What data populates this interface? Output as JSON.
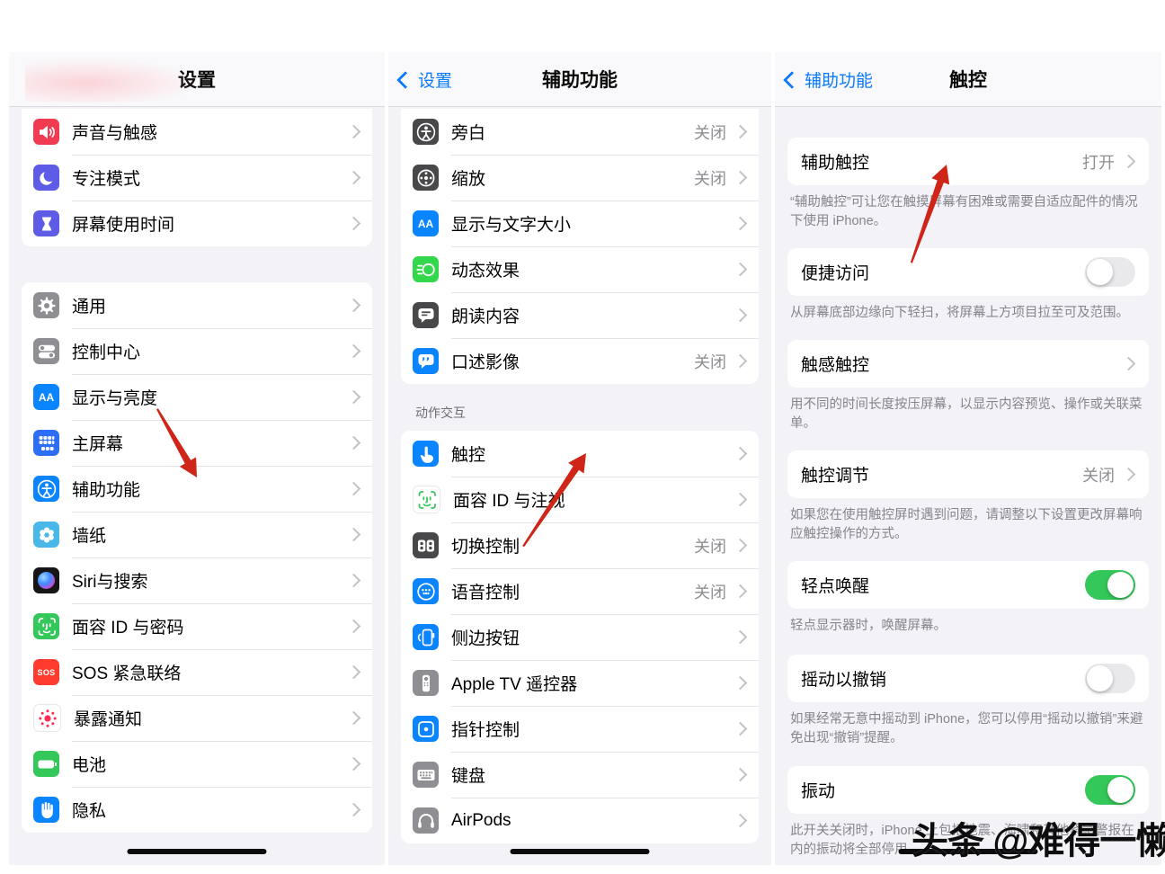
{
  "watermark": "头条 @难得一懒",
  "colors": {
    "accent_blue": "#0a7aff",
    "toggle_on_green": "#34c759",
    "toggle_off_gray": "#e9e9eb",
    "panel_background": "#f2f2f7",
    "value_gray": "#8e8e93",
    "arrow_red": "#cf2418"
  },
  "icon_labels": {
    "aa": "AA",
    "sos": "SOS"
  },
  "settings": {
    "title": "设置",
    "group1": [
      {
        "label": "声音与触感",
        "icon": "speaker-icon"
      },
      {
        "label": "专注模式",
        "icon": "moon-icon"
      },
      {
        "label": "屏幕使用时间",
        "icon": "hourglass-icon"
      }
    ],
    "group2": [
      {
        "label": "通用",
        "icon": "gear-icon"
      },
      {
        "label": "控制中心",
        "icon": "control-center-icon"
      },
      {
        "label": "显示与亮度",
        "icon": "text-size-icon"
      },
      {
        "label": "主屏幕",
        "icon": "home-screen-grid-icon"
      },
      {
        "label": "辅助功能",
        "icon": "accessibility-icon"
      },
      {
        "label": "墙纸",
        "icon": "flower-icon"
      },
      {
        "label": "Siri与搜索",
        "icon": "siri-orb-icon"
      },
      {
        "label": "面容 ID 与密码",
        "icon": "face-id-icon"
      },
      {
        "label": "SOS 紧急联络",
        "icon": "sos-icon"
      },
      {
        "label": "暴露通知",
        "icon": "exposure-dots-icon"
      },
      {
        "label": "电池",
        "icon": "battery-icon"
      },
      {
        "label": "隐私",
        "icon": "hand-icon"
      }
    ]
  },
  "accessibility": {
    "back": "设置",
    "title": "辅助功能",
    "group1": [
      {
        "label": "旁白",
        "value": "关闭",
        "icon": "voiceover-icon"
      },
      {
        "label": "缩放",
        "value": "关闭",
        "icon": "zoom-icon"
      },
      {
        "label": "显示与文字大小",
        "icon": "text-size-icon"
      },
      {
        "label": "动态效果",
        "icon": "motion-icon"
      },
      {
        "label": "朗读内容",
        "icon": "speech-bubble-icon"
      },
      {
        "label": "口述影像",
        "value": "关闭",
        "icon": "audio-description-icon"
      }
    ],
    "section": "动作交互",
    "group2": [
      {
        "label": "触控",
        "icon": "touch-hand-icon"
      },
      {
        "label": "面容 ID 与注视",
        "icon": "face-id-attention-icon"
      },
      {
        "label": "切换控制",
        "value": "关闭",
        "icon": "switch-control-icon"
      },
      {
        "label": "语音控制",
        "value": "关闭",
        "icon": "voice-control-icon"
      },
      {
        "label": "侧边按钮",
        "icon": "side-button-icon"
      },
      {
        "label": "Apple TV 遥控器",
        "icon": "tv-remote-icon"
      },
      {
        "label": "指针控制",
        "icon": "pointer-control-icon"
      },
      {
        "label": "键盘",
        "icon": "keyboard-icon"
      },
      {
        "label": "AirPods",
        "icon": "headphones-icon"
      }
    ]
  },
  "touch": {
    "back": "辅助功能",
    "title": "触控",
    "assistive": {
      "label": "辅助触控",
      "value": "打开",
      "footer": "“辅助触控”可让您在触摸屏幕有困难或需要自适应配件的情况下使用 iPhone。"
    },
    "reachability": {
      "label": "便捷访问",
      "toggle": "off",
      "footer": "从屏幕底部边缘向下轻扫，将屏幕上方项目拉至可及范围。"
    },
    "haptic": {
      "label": "触感触控",
      "footer": "用不同的时间长度按压屏幕，以显示内容预览、操作或关联菜单。"
    },
    "accommodations": {
      "label": "触控调节",
      "value": "关闭",
      "footer": "如果您在使用触控屏时遇到问题，请调整以下设置更改屏幕响应触控操作的方式。"
    },
    "tap_wake": {
      "label": "轻点唤醒",
      "toggle": "on",
      "footer": "轻点显示器时，唤醒屏幕。"
    },
    "shake_undo": {
      "label": "摇动以撤销",
      "toggle": "off",
      "footer": "如果经常无意中摇动到 iPhone，您可以停用“摇动以撤销”来避免出现“撤销”提醒。"
    },
    "vibration": {
      "label": "振动",
      "toggle": "on",
      "footer": "此开关关闭时，iPhone 上包括地震、海啸和其他紧急警报在内的振动将全部停用。"
    }
  }
}
